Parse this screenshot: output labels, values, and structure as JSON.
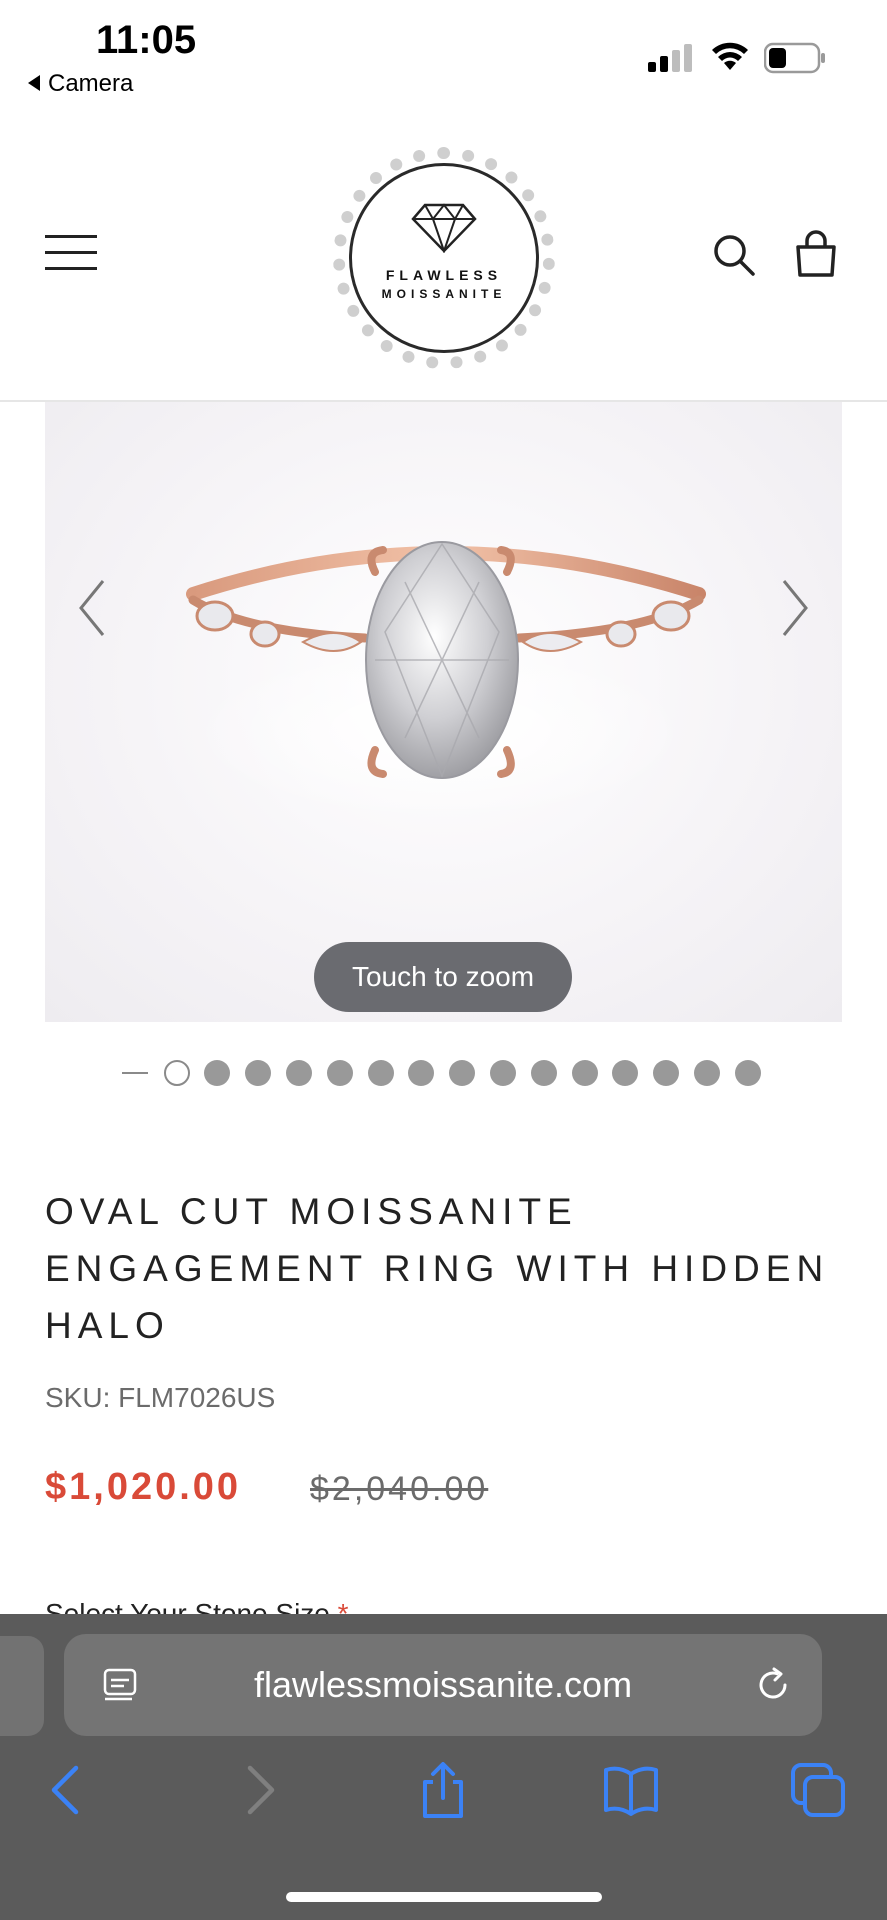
{
  "status_bar": {
    "time": "11:05",
    "back_app": "Camera"
  },
  "header": {
    "logo_line1": "FLAWLESS",
    "logo_line2": "MOISSANITE",
    "icons": [
      "menu-icon",
      "search-icon",
      "shopping-bag-icon"
    ]
  },
  "gallery": {
    "zoom_hint": "Touch to zoom",
    "image_count": 15,
    "active_index": 0
  },
  "product": {
    "title": "OVAL CUT MOISSANITE ENGAGEMENT RING WITH HIDDEN HALO",
    "sku": "SKU: FLM7026US",
    "price": "$1,020.00",
    "original_price": "$2,040.00",
    "select_label": "Select Your Stone Size",
    "required_mark": "*"
  },
  "browser": {
    "url": "flawlessmoissanite.com"
  },
  "colors": {
    "sale_price": "#d94a38",
    "safari_blue": "#3b82f6",
    "chrome_bg": "#5b5b5b"
  }
}
